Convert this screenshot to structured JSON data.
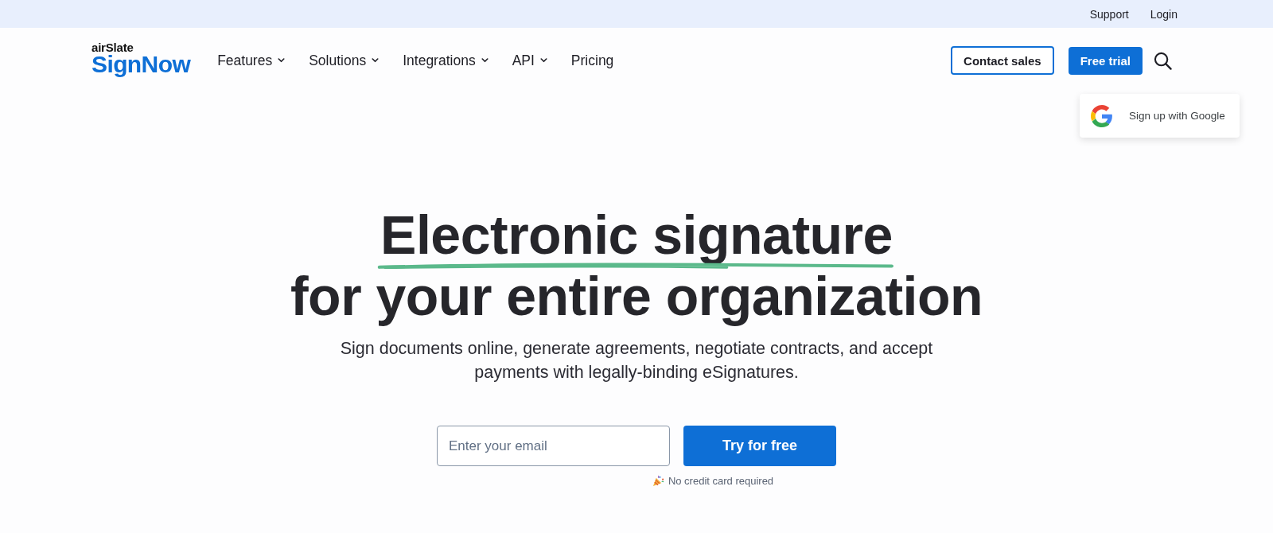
{
  "top_bar": {
    "links": [
      "Support",
      "Login"
    ]
  },
  "header": {
    "logo": {
      "overline": "airSlate",
      "wordmark": "SignNow"
    },
    "nav": [
      {
        "label": "Features",
        "dropdown": true
      },
      {
        "label": "Solutions",
        "dropdown": true
      },
      {
        "label": "Integrations",
        "dropdown": true
      },
      {
        "label": "API",
        "dropdown": true
      },
      {
        "label": "Pricing",
        "dropdown": false
      }
    ],
    "contact_button": "Contact sales",
    "trial_button": "Free trial"
  },
  "google_popup": {
    "label": "Sign up with Google"
  },
  "hero": {
    "title_line_1": "Electronic signature",
    "title_line_2": "for your entire organization",
    "subtitle": "Sign documents online, generate agreements, negotiate contracts, and accept payments with legally-binding eSignatures.",
    "email": {
      "placeholder": "Enter your email"
    },
    "cta": "Try for free",
    "note": "No credit card required"
  }
}
